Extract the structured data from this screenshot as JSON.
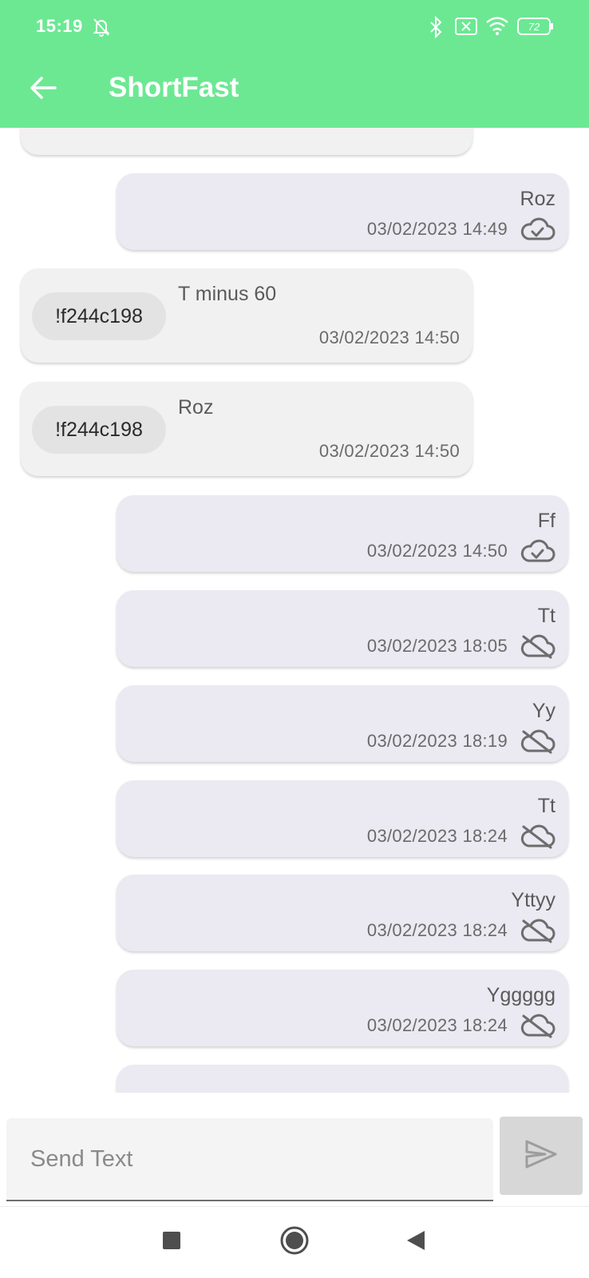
{
  "status_bar": {
    "time": "15:19",
    "icons": [
      "bell-off-icon",
      "bluetooth-icon",
      "sim-off-icon",
      "wifi-icon",
      "battery-icon"
    ],
    "battery": "72"
  },
  "app_bar": {
    "title": "ShortFast",
    "back_icon": "arrow-left-icon"
  },
  "messages": [
    {
      "direction": "out",
      "text": "Roz",
      "time": "03/02/2023 14:49",
      "status": "sent"
    },
    {
      "direction": "in",
      "sender": "!f244c198",
      "text": "T minus 60",
      "time": "03/02/2023 14:50"
    },
    {
      "direction": "in",
      "sender": "!f244c198",
      "text": "Roz",
      "time": "03/02/2023 14:50"
    },
    {
      "direction": "out",
      "text": "Ff",
      "time": "03/02/2023 14:50",
      "status": "sent"
    },
    {
      "direction": "out",
      "text": "Tt",
      "time": "03/02/2023 18:05",
      "status": "not-sent"
    },
    {
      "direction": "out",
      "text": "Yy",
      "time": "03/02/2023 18:19",
      "status": "not-sent"
    },
    {
      "direction": "out",
      "text": "Tt",
      "time": "03/02/2023 18:24",
      "status": "not-sent"
    },
    {
      "direction": "out",
      "text": "Yttyy",
      "time": "03/02/2023 18:24",
      "status": "not-sent"
    },
    {
      "direction": "out",
      "text": "Yggggg",
      "time": "03/02/2023 18:24",
      "status": "not-sent"
    }
  ],
  "composer": {
    "placeholder": "Send Text",
    "value": "",
    "send_icon": "send-icon"
  },
  "nav_bar": {
    "buttons": [
      "recents-square-icon",
      "home-circle-icon",
      "back-triangle-icon"
    ]
  },
  "colors": {
    "accent": "#6ce893",
    "bubble_out": "#ebe9f1",
    "bubble_in": "#f1f1f1"
  }
}
